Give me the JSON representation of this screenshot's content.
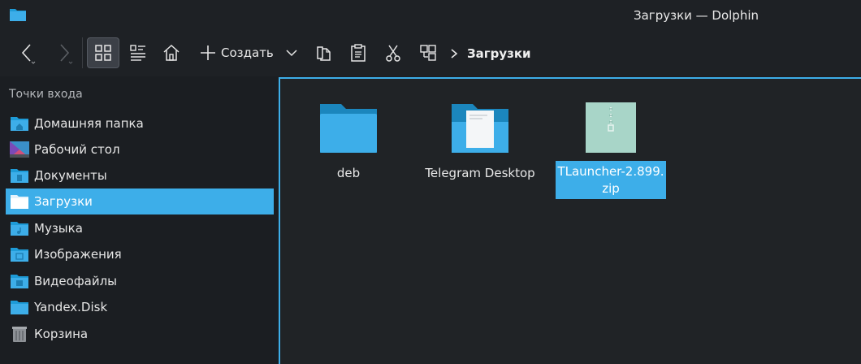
{
  "window": {
    "title": "Загрузки — Dolphin",
    "app_icon": "folder-icon"
  },
  "toolbar": {
    "back_icon": "chevron-left-icon",
    "forward_icon": "chevron-right-icon",
    "icons_view_icon": "grid-view-icon",
    "details_view_icon": "details-view-icon",
    "home_icon": "home-icon",
    "create_label": "Создать",
    "copy_icon": "copy-icon",
    "paste_icon": "paste-icon",
    "cut_icon": "scissors-icon",
    "split_icon": "split-view-icon",
    "breadcrumb": "Загрузки"
  },
  "sidebar": {
    "heading": "Точки входа",
    "items": [
      {
        "label": "Домашняя папка",
        "icon": "home-folder-icon"
      },
      {
        "label": "Рабочий стол",
        "icon": "desktop-icon"
      },
      {
        "label": "Документы",
        "icon": "documents-folder-icon"
      },
      {
        "label": "Загрузки",
        "icon": "downloads-folder-icon",
        "selected": true
      },
      {
        "label": "Музыка",
        "icon": "music-folder-icon"
      },
      {
        "label": "Изображения",
        "icon": "pictures-folder-icon"
      },
      {
        "label": "Видеофайлы",
        "icon": "videos-folder-icon"
      },
      {
        "label": "Yandex.Disk",
        "icon": "folder-icon"
      },
      {
        "label": "Корзина",
        "icon": "trash-icon"
      }
    ]
  },
  "files": [
    {
      "name": "deb",
      "type": "folder"
    },
    {
      "name": "Telegram Desktop",
      "type": "folder"
    },
    {
      "name_line1": "TLauncher-2.899.",
      "name_line2": "zip",
      "type": "zip",
      "selected": true
    }
  ],
  "colors": {
    "accent": "#3daee9",
    "folder": "#1e9bd7",
    "background": "#1b1e22"
  }
}
